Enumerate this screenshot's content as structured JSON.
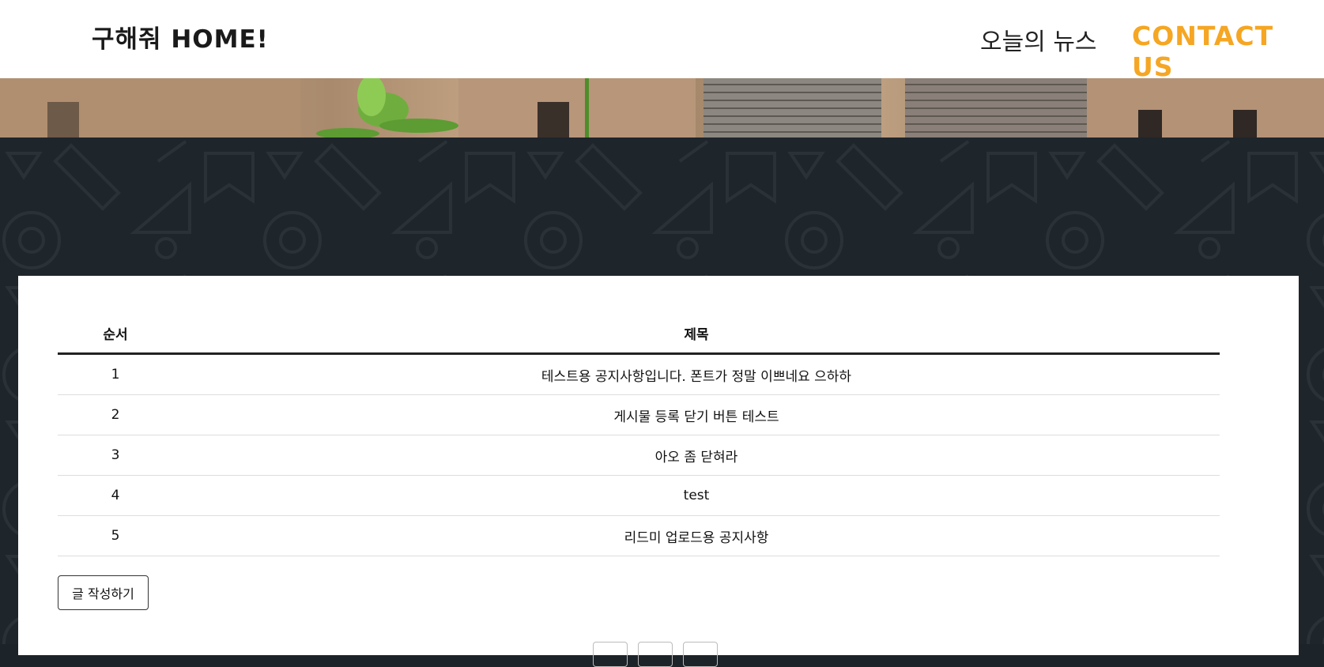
{
  "header": {
    "brand": "구해줘 HOME!",
    "nav": {
      "news": "오늘의 뉴스",
      "contact": "CONTACT US"
    },
    "accent_color": "#f5a623"
  },
  "board": {
    "columns": [
      "순서",
      "제목"
    ],
    "rows": [
      {
        "num": "1",
        "title": "테스트용 공지사항입니다. 폰트가 정말 이쁘네요 으하하"
      },
      {
        "num": "2",
        "title": "게시물 등록 닫기 버튼 테스트"
      },
      {
        "num": "3",
        "title": "아오 좀 닫혀라"
      },
      {
        "num": "4",
        "title": "test"
      },
      {
        "num": "5",
        "title": "리드미 업로드용 공지사항"
      }
    ],
    "write_button": "글 작성하기"
  },
  "hero_image": "house-coins-plant-banner",
  "pattern": "education-icons-pattern"
}
